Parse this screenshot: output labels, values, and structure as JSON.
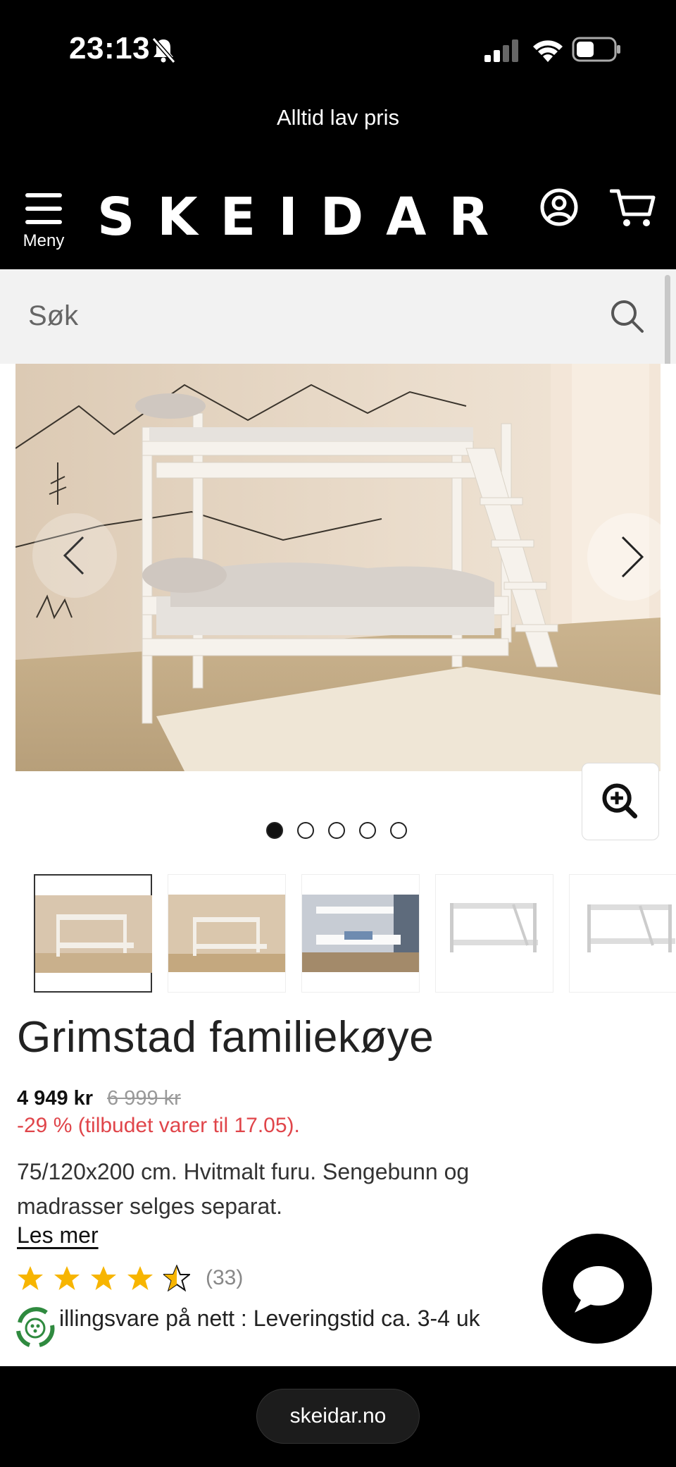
{
  "status_bar": {
    "time": "23:13"
  },
  "promo": {
    "text": "Alltid lav pris"
  },
  "header": {
    "logo": "SKEIDAR",
    "menu_label": "Meny"
  },
  "search": {
    "placeholder": "Søk"
  },
  "gallery": {
    "image_count": 5,
    "active_index": 0
  },
  "product": {
    "title": "Grimstad familiekøye",
    "price": "4 949 kr",
    "old_price": "6 999 kr",
    "discount": "-29 % (tilbudet varer til 17.05).",
    "description": "75/120x200 cm. Hvitmalt furu. Sengebunn og madrasser selges separat.",
    "read_more": "Les mer",
    "rating": 4.5,
    "review_count": "(33)",
    "delivery": "illingsvare på nett : Leveringstid ca. 3-4 uk"
  },
  "browser": {
    "url": "skeidar.no"
  },
  "colors": {
    "accent_discount": "#e0454a",
    "star": "#f7b500",
    "header_bg": "#000000"
  }
}
